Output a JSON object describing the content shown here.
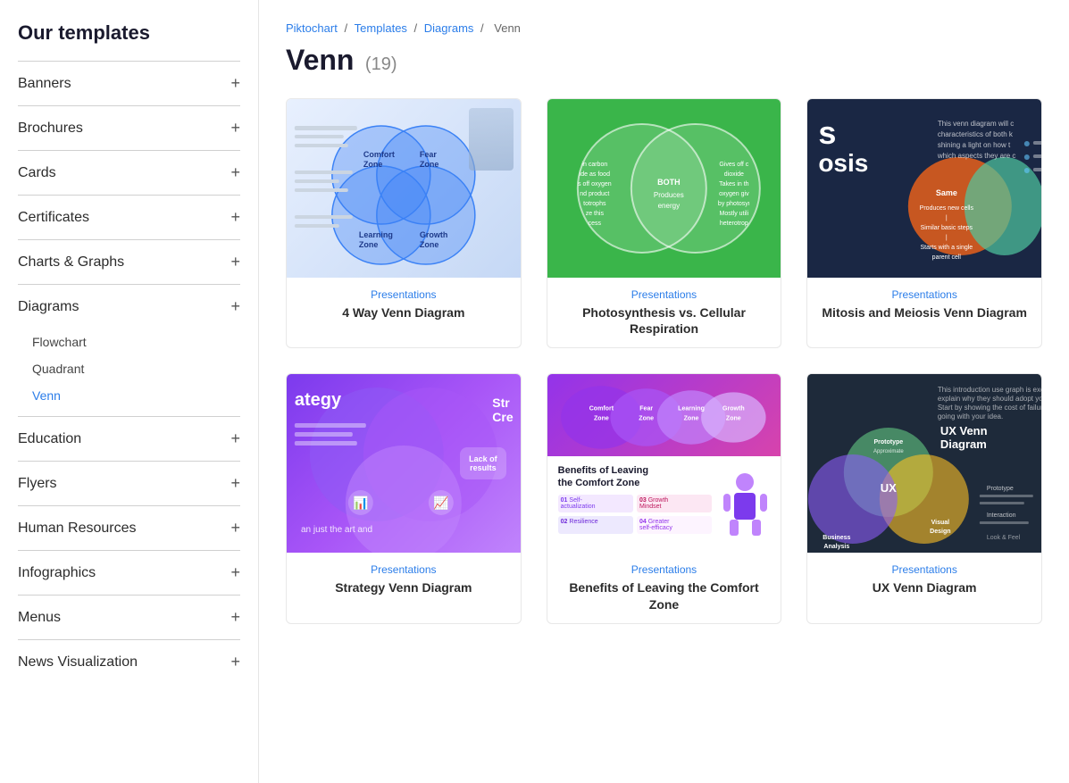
{
  "sidebar": {
    "title": "Our templates",
    "items": [
      {
        "id": "banners",
        "label": "Banners",
        "expandable": true,
        "expanded": false
      },
      {
        "id": "brochures",
        "label": "Brochures",
        "expandable": true,
        "expanded": false
      },
      {
        "id": "cards",
        "label": "Cards",
        "expandable": true,
        "expanded": false
      },
      {
        "id": "certificates",
        "label": "Certificates",
        "expandable": true,
        "expanded": false
      },
      {
        "id": "charts-graphs",
        "label": "Charts & Graphs",
        "expandable": true,
        "expanded": false
      },
      {
        "id": "diagrams",
        "label": "Diagrams",
        "expandable": true,
        "expanded": true,
        "subitems": [
          {
            "id": "flowchart",
            "label": "Flowchart",
            "active": false
          },
          {
            "id": "quadrant",
            "label": "Quadrant",
            "active": false
          },
          {
            "id": "venn",
            "label": "Venn",
            "active": true
          }
        ]
      },
      {
        "id": "education",
        "label": "Education",
        "expandable": true,
        "expanded": false
      },
      {
        "id": "flyers",
        "label": "Flyers",
        "expandable": true,
        "expanded": false
      },
      {
        "id": "human-resources",
        "label": "Human Resources",
        "expandable": true,
        "expanded": false
      },
      {
        "id": "infographics",
        "label": "Infographics",
        "expandable": true,
        "expanded": false
      },
      {
        "id": "menus",
        "label": "Menus",
        "expandable": true,
        "expanded": false
      },
      {
        "id": "news-visualization",
        "label": "News Visualization",
        "expandable": true,
        "expanded": false
      }
    ]
  },
  "breadcrumb": {
    "parts": [
      "Piktochart",
      "Templates",
      "Diagrams",
      "Venn"
    ],
    "separators": [
      "/",
      "/",
      "/"
    ]
  },
  "page": {
    "title": "Venn",
    "count": "(19)"
  },
  "templates": [
    {
      "id": "4-way-venn",
      "category": "Presentations",
      "name": "4 Way Venn Diagram",
      "thumbnail_type": "venn-blue"
    },
    {
      "id": "photosynthesis",
      "category": "Presentations",
      "name": "Photosynthesis vs. Cellular Respiration",
      "thumbnail_type": "venn-green"
    },
    {
      "id": "mitosis",
      "category": "Presentations",
      "name": "Mitosis and Meiosis Venn Diagram",
      "thumbnail_type": "venn-dark"
    },
    {
      "id": "strategy-venn",
      "category": "Presentations",
      "name": "Strategy Venn Diagram",
      "thumbnail_type": "venn-purple"
    },
    {
      "id": "comfort-zone",
      "category": "Presentations",
      "name": "Benefits of Leaving the Comfort Zone",
      "thumbnail_type": "comfort-zone"
    },
    {
      "id": "ux-venn",
      "category": "Presentations",
      "name": "UX Venn Diagram",
      "thumbnail_type": "ux"
    }
  ],
  "colors": {
    "accent": "#2b7de9",
    "sidebar_bg": "#ffffff",
    "active_link": "#2b7de9"
  }
}
